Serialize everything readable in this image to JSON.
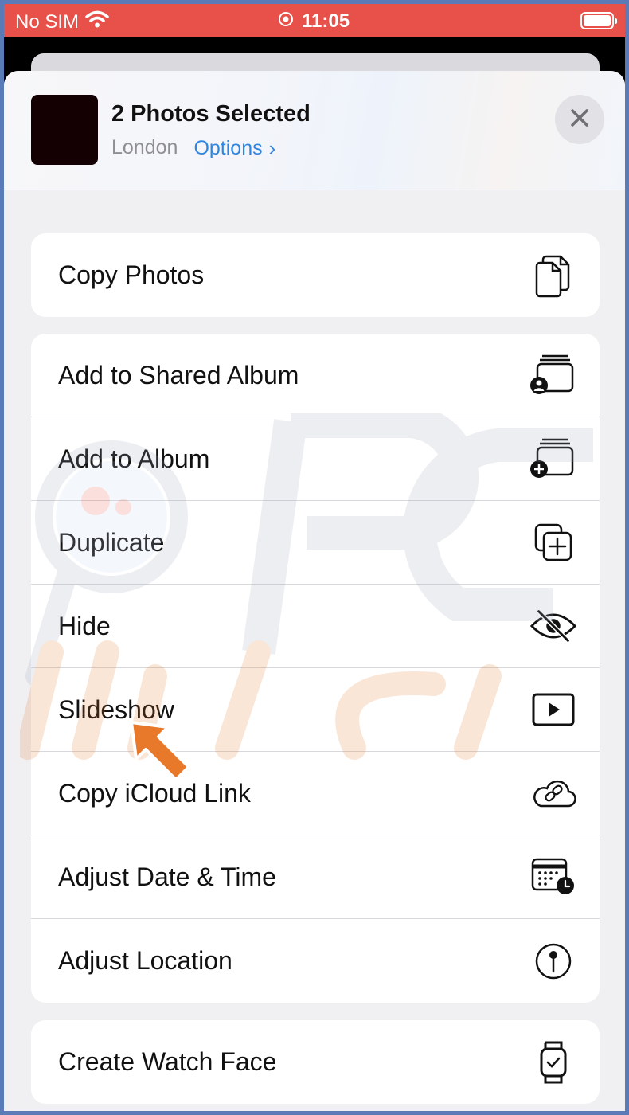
{
  "status": {
    "carrier": "No SIM",
    "time": "11:05"
  },
  "sheet_header": {
    "title": "2 Photos Selected",
    "location": "London",
    "options_label": "Options",
    "options_chevron": "›"
  },
  "groups": [
    {
      "items": [
        {
          "label": "Copy Photos",
          "icon": "copy-icon"
        }
      ]
    },
    {
      "items": [
        {
          "label": "Add to Shared Album",
          "icon": "shared-album-icon"
        },
        {
          "label": "Add to Album",
          "icon": "add-album-icon"
        },
        {
          "label": "Duplicate",
          "icon": "duplicate-icon"
        },
        {
          "label": "Hide",
          "icon": "eye-slash-icon"
        },
        {
          "label": "Slideshow",
          "icon": "play-rectangle-icon"
        },
        {
          "label": "Copy iCloud Link",
          "icon": "cloud-link-icon"
        },
        {
          "label": "Adjust Date & Time",
          "icon": "calendar-clock-icon"
        },
        {
          "label": "Adjust Location",
          "icon": "location-pin-icon"
        }
      ]
    },
    {
      "items": [
        {
          "label": "Create Watch Face",
          "icon": "watch-icon"
        }
      ]
    }
  ],
  "colors": {
    "status_bar": "#e8514a",
    "link": "#2f86e0",
    "pointer_arrow": "#e8782a"
  }
}
